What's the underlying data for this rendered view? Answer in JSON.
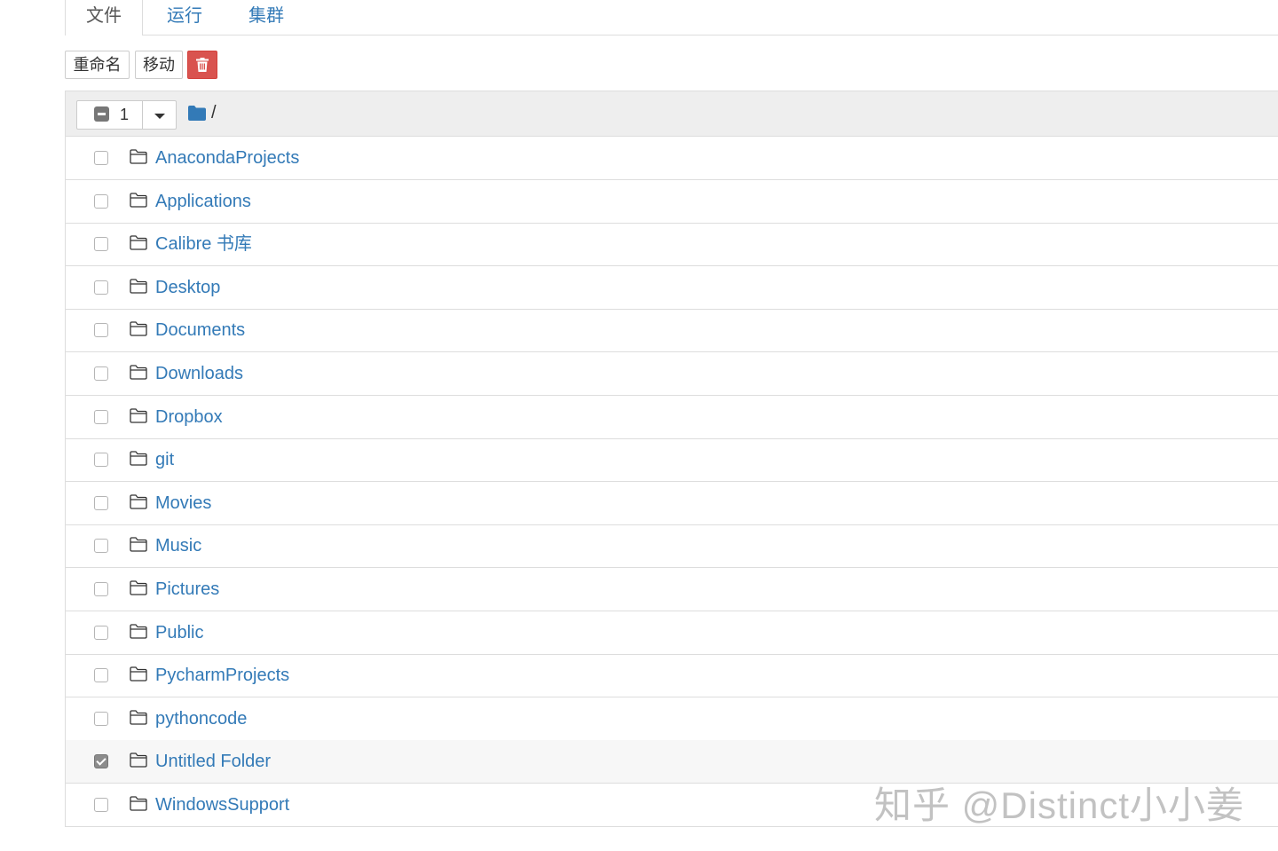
{
  "tabs": [
    {
      "label": "文件",
      "active": true
    },
    {
      "label": "运行",
      "active": false
    },
    {
      "label": "集群",
      "active": false
    }
  ],
  "toolbar": {
    "rename_label": "重命名",
    "move_label": "移动",
    "delete_icon": "trash-icon"
  },
  "list_header": {
    "selected_count": "1",
    "path": "/"
  },
  "items": [
    {
      "name": "AnacondaProjects",
      "checked": false
    },
    {
      "name": "Applications",
      "checked": false
    },
    {
      "name": "Calibre 书库",
      "checked": false
    },
    {
      "name": "Desktop",
      "checked": false
    },
    {
      "name": "Documents",
      "checked": false
    },
    {
      "name": "Downloads",
      "checked": false
    },
    {
      "name": "Dropbox",
      "checked": false
    },
    {
      "name": "git",
      "checked": false
    },
    {
      "name": "Movies",
      "checked": false
    },
    {
      "name": "Music",
      "checked": false
    },
    {
      "name": "Pictures",
      "checked": false
    },
    {
      "name": "Public",
      "checked": false
    },
    {
      "name": "PycharmProjects",
      "checked": false
    },
    {
      "name": "pythoncode",
      "checked": false
    },
    {
      "name": "Untitled Folder",
      "checked": true
    },
    {
      "name": "WindowsSupport",
      "checked": false
    }
  ],
  "watermark": "知乎 @Distinct小小姜",
  "colors": {
    "link": "#337ab7",
    "danger": "#d9534f",
    "header_bg": "#eeeeee",
    "border": "#dddddd"
  }
}
